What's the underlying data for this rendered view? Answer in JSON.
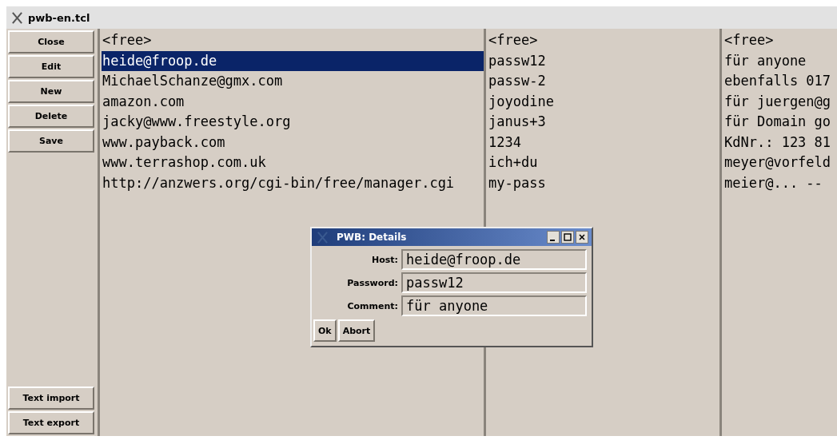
{
  "window": {
    "title": "pwb-en.tcl"
  },
  "side_buttons": [
    "Close",
    "Edit",
    "New",
    "Delete",
    "Save"
  ],
  "bottom_buttons": [
    "Text import",
    "Text export"
  ],
  "rows": [
    {
      "host": "<free>",
      "password": "<free>",
      "comment": "<free>",
      "selected": false
    },
    {
      "host": "heide@froop.de",
      "password": "passw12",
      "comment": "für anyone",
      "selected": true
    },
    {
      "host": "MichaelSchanze@gmx.com",
      "password": "passw-2",
      "comment": "ebenfalls 017",
      "selected": false
    },
    {
      "host": "amazon.com",
      "password": "joyodine",
      "comment": "für juergen@g",
      "selected": false
    },
    {
      "host": "jacky@www.freestyle.org",
      "password": "janus+3",
      "comment": "für Domain go",
      "selected": false
    },
    {
      "host": "www.payback.com",
      "password": "1234",
      "comment": "KdNr.: 123 81",
      "selected": false
    },
    {
      "host": "www.terrashop.com.uk",
      "password": "ich+du",
      "comment": "meyer@vorfeld",
      "selected": false
    },
    {
      "host": "http://anzwers.org/cgi-bin/free/manager.cgi",
      "password": "my-pass",
      "comment": "meier@... --",
      "selected": false
    }
  ],
  "dialog": {
    "title": "PWB: Details",
    "fields": [
      {
        "label": "Host:",
        "value": "heide@froop.de"
      },
      {
        "label": "Password:",
        "value": "passw12"
      },
      {
        "label": "Comment:",
        "value": "für anyone"
      }
    ],
    "buttons": [
      "Ok",
      "Abort"
    ]
  }
}
